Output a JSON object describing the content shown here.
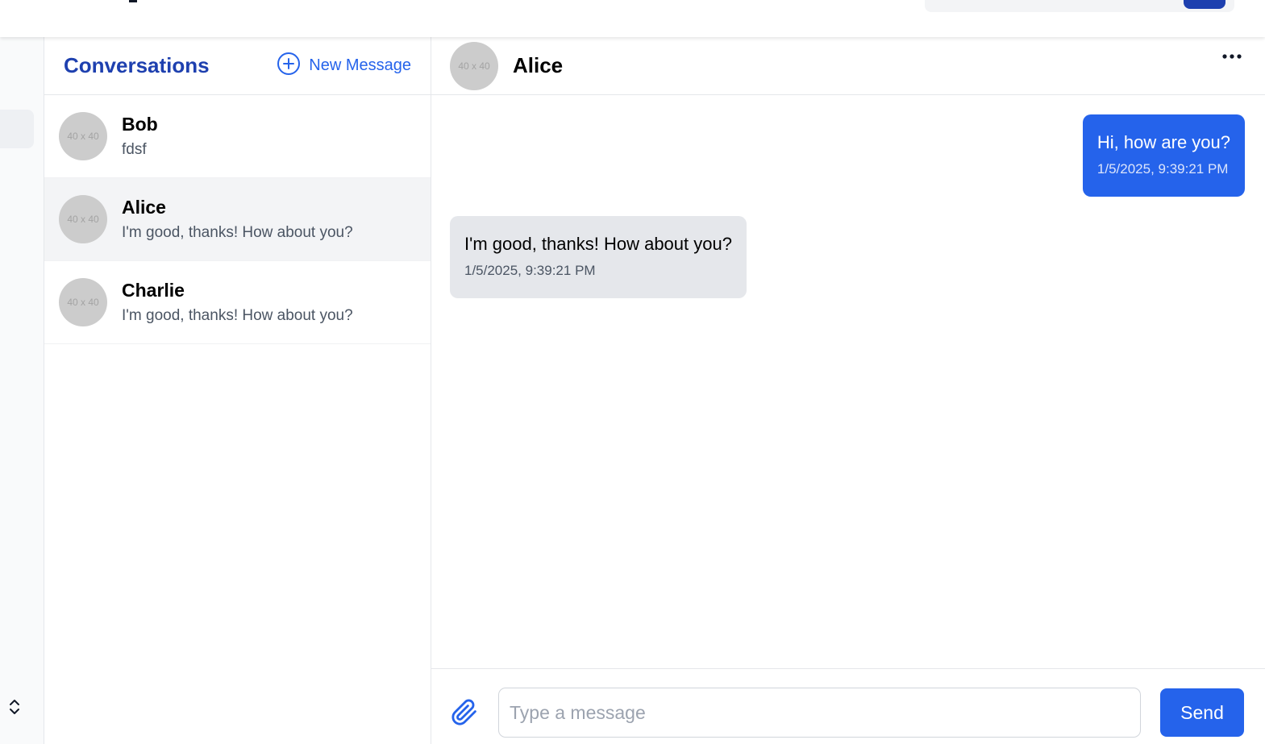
{
  "app": {
    "colors": {
      "accent": "#2563eb",
      "title_blue": "#1e40af",
      "incoming_bubble": "#e5e7eb",
      "active_row": "#f3f4f6"
    }
  },
  "sidebar": {
    "toggle_icon": "chevron-up-down-icon"
  },
  "conversations": {
    "title": "Conversations",
    "new_message_label": "New Message",
    "new_message_icon": "plus-circle-icon",
    "items": [
      {
        "name": "Bob",
        "preview": "fdsf",
        "avatar_text": "40 x 40",
        "active": false
      },
      {
        "name": "Alice",
        "preview": "I'm good, thanks! How about you?",
        "avatar_text": "40 x 40",
        "active": true
      },
      {
        "name": "Charlie",
        "preview": "I'm good, thanks! How about you?",
        "avatar_text": "40 x 40",
        "active": false
      }
    ]
  },
  "chat": {
    "contact_name": "Alice",
    "avatar_text": "40 x 40",
    "more_icon": "more-horizontal-icon",
    "messages": [
      {
        "direction": "outgoing",
        "text": "Hi, how are you?",
        "time": "1/5/2025, 9:39:21 PM"
      },
      {
        "direction": "incoming",
        "text": "I'm good, thanks! How about you?",
        "time": "1/5/2025, 9:39:21 PM"
      }
    ]
  },
  "composer": {
    "attach_icon": "paperclip-icon",
    "placeholder": "Type a message",
    "value": "",
    "send_label": "Send"
  }
}
